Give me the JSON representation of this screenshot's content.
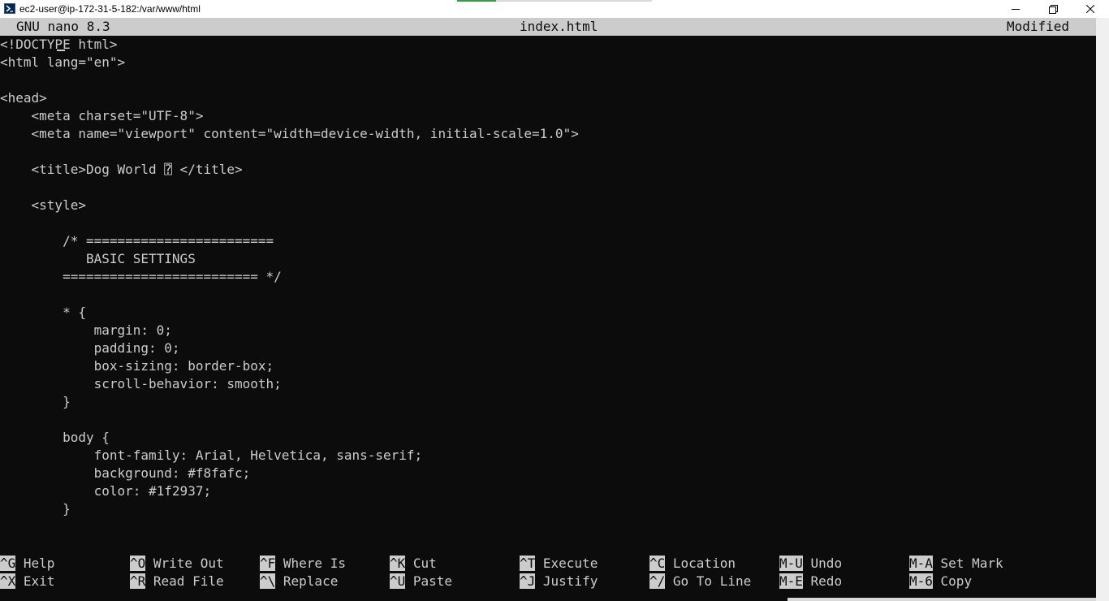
{
  "window": {
    "title": "ec2-user@ip-172-31-5-182:/var/www/html",
    "controls": [
      "minimize-icon",
      "maximize-icon",
      "close-icon"
    ]
  },
  "nano": {
    "version": "GNU nano 8.3",
    "filename": "index.html",
    "status": "Modified"
  },
  "editor": {
    "lines": [
      "<!DOCTYPE html>",
      "<html lang=\"en\">",
      "",
      "<head>",
      "    <meta charset=\"UTF-8\">",
      "    <meta name=\"viewport\" content=\"width=device-width, initial-scale=1.0\">",
      "",
      "    <title>Dog World ⍰ </title>",
      "",
      "    <style>",
      "",
      "        /* ========================",
      "           BASIC SETTINGS",
      "        ========================= */",
      "",
      "        * {",
      "            margin: 0;",
      "            padding: 0;",
      "            box-sizing: border-box;",
      "            scroll-behavior: smooth;",
      "        }",
      "",
      "        body {",
      "            font-family: Arial, Helvetica, sans-serif;",
      "            background: #f8fafc;",
      "            color: #1f2937;",
      "        }"
    ]
  },
  "shortcuts": [
    {
      "key": "^G",
      "label": "Help"
    },
    {
      "key": "^X",
      "label": "Exit"
    },
    {
      "key": "^O",
      "label": "Write Out"
    },
    {
      "key": "^R",
      "label": "Read File"
    },
    {
      "key": "^F",
      "label": "Where Is"
    },
    {
      "key": "^\\",
      "label": "Replace"
    },
    {
      "key": "^K",
      "label": "Cut"
    },
    {
      "key": "^U",
      "label": "Paste"
    },
    {
      "key": "^T",
      "label": "Execute"
    },
    {
      "key": "^J",
      "label": "Justify"
    },
    {
      "key": "^C",
      "label": "Location"
    },
    {
      "key": "^/",
      "label": "Go To Line"
    },
    {
      "key": "M-U",
      "label": "Undo"
    },
    {
      "key": "M-E",
      "label": "Redo"
    },
    {
      "key": "M-A",
      "label": "Set Mark"
    },
    {
      "key": "M-6",
      "label": "Copy"
    }
  ]
}
